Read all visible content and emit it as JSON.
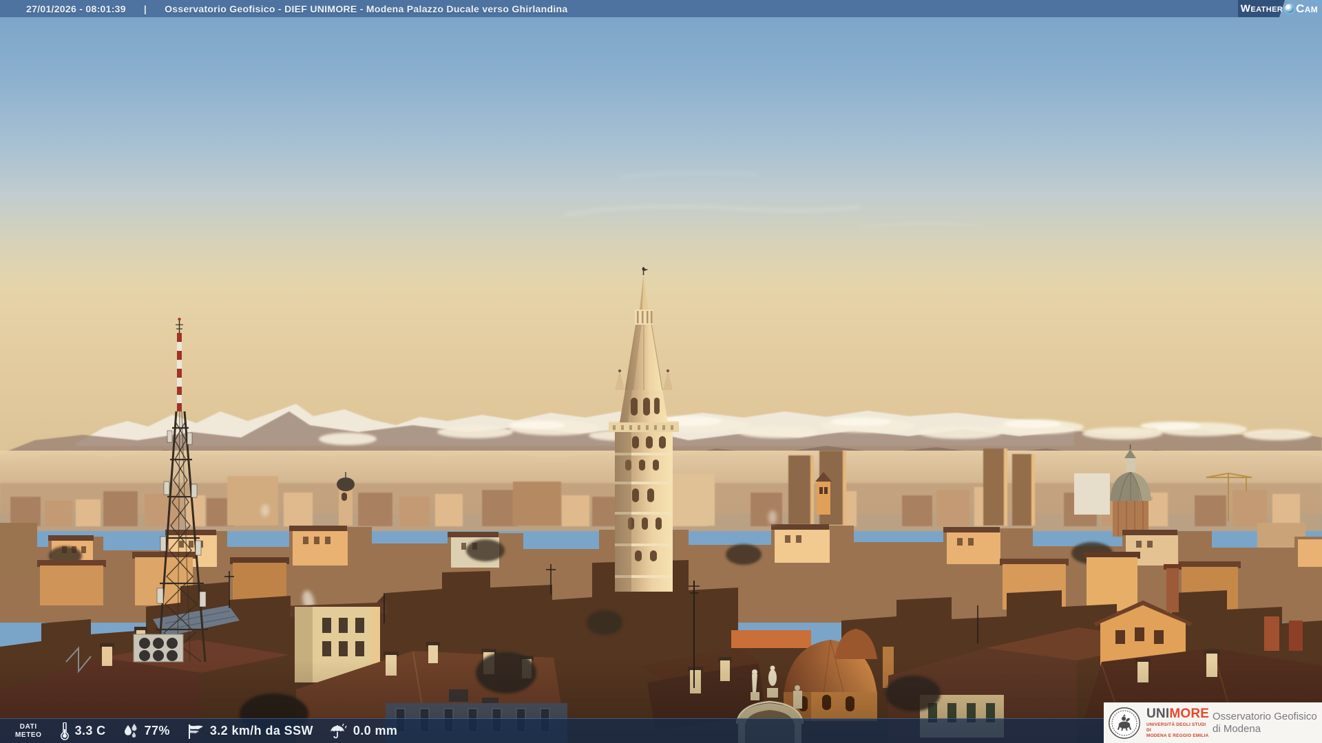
{
  "header": {
    "timestamp": "27/01/2026 - 08:01:39",
    "separator": "|",
    "title": "Osservatorio Geofisico - DIEF UNIMORE - Modena Palazzo Ducale verso Ghirlandina",
    "background_color": "#4e73a0"
  },
  "weathercam_logo": {
    "word1": "Weather",
    "word2": "Cam"
  },
  "weather_bar": {
    "label_line1": "DATI",
    "label_line2": "METEO",
    "temperature": "3.3 C",
    "humidity": "77%",
    "wind": "3.2 km/h da SSW",
    "precipitation": "0.0 mm",
    "background_color": "rgba(22,44,76,0.75)"
  },
  "branding": {
    "wordmark_uni": "UNI",
    "wordmark_more": "MORE",
    "university_line1": "UNIVERSITÀ DEGLI STUDI DI",
    "university_line2": "MODENA E REGGIO EMILIA",
    "org_line1": "Osservatorio Geofisico",
    "org_line2": "di Modena",
    "accent_color": "#e8472b"
  },
  "scene": {
    "subject": "Sunrise webcam view over Modena rooftops toward the Ghirlandina tower, telecom lattice mast at left, snow-capped mountains and a cloud bank on the horizon",
    "sky_top_color": "#78a3c7",
    "sky_horizon_color": "#e5d4aa",
    "sunlight_color": "#e8a55c",
    "landmarks": [
      "ghirlandina-tower",
      "telecom-mast",
      "church-dome",
      "san-giorgio-church",
      "apennine-ridge",
      "alps-snow-peaks"
    ]
  }
}
